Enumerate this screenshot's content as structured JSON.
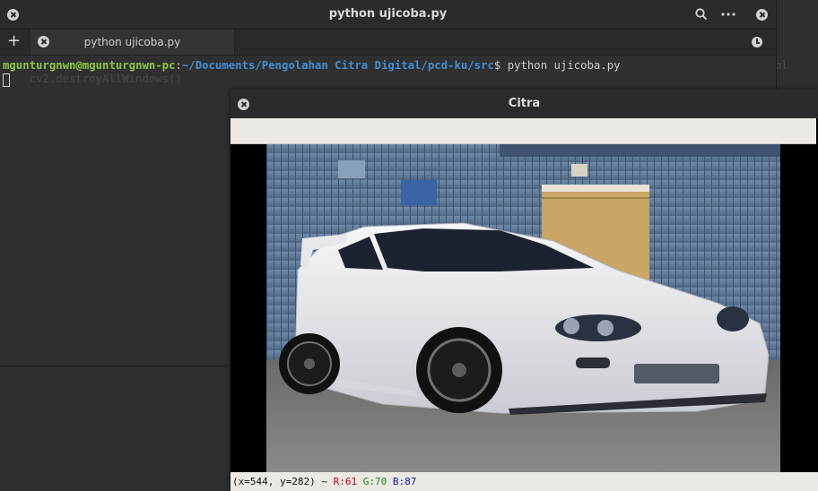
{
  "terminal": {
    "title": "python ujicoba.py",
    "tab_label": "python ujicoba.py",
    "new_tab_symbol": "+",
    "menu_symbol": "•••",
    "search_symbol": "⚲",
    "prompt_user": "mgunturgnwn@mgunturgnwn-pc",
    "prompt_sep": ":",
    "prompt_path": "~/Documents/Pengolahan Citra Digital/pcd-ku/src",
    "prompt_dollar": "$ ",
    "command": "python ujicoba.py",
    "ghost_line": "    cv2.destroyAllWindows()",
    "ghost_right": "ol"
  },
  "image_window": {
    "title": "Citra",
    "status": {
      "coords": "(x=544, y=282) ~ ",
      "r": "R:61",
      "g": "G:70",
      "b": "B:87"
    }
  },
  "colors": {
    "prompt_user": "#8ec63f",
    "prompt_path": "#3f8fd2"
  }
}
